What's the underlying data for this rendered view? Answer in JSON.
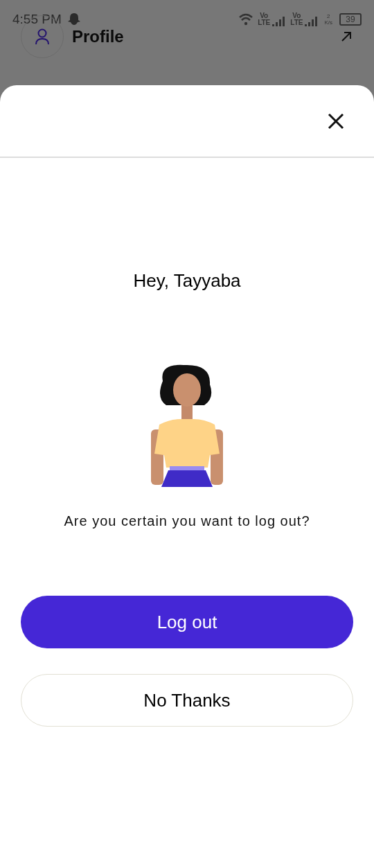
{
  "status_bar": {
    "time": "4:55 PM",
    "sims": [
      {
        "top": "Vo",
        "bottom": "LTE"
      },
      {
        "top": "Vo",
        "bottom": "LTE"
      }
    ],
    "speed_value": "2",
    "speed_unit": "K/s",
    "battery": "39"
  },
  "header": {
    "title": "Profile"
  },
  "dialog": {
    "greeting": "Hey, Tayyaba",
    "message": "Are you certain you want to log out?",
    "buttons": [
      {
        "label": "Log out",
        "kind": "primary"
      },
      {
        "label": "No Thanks",
        "kind": "secondary"
      }
    ]
  }
}
